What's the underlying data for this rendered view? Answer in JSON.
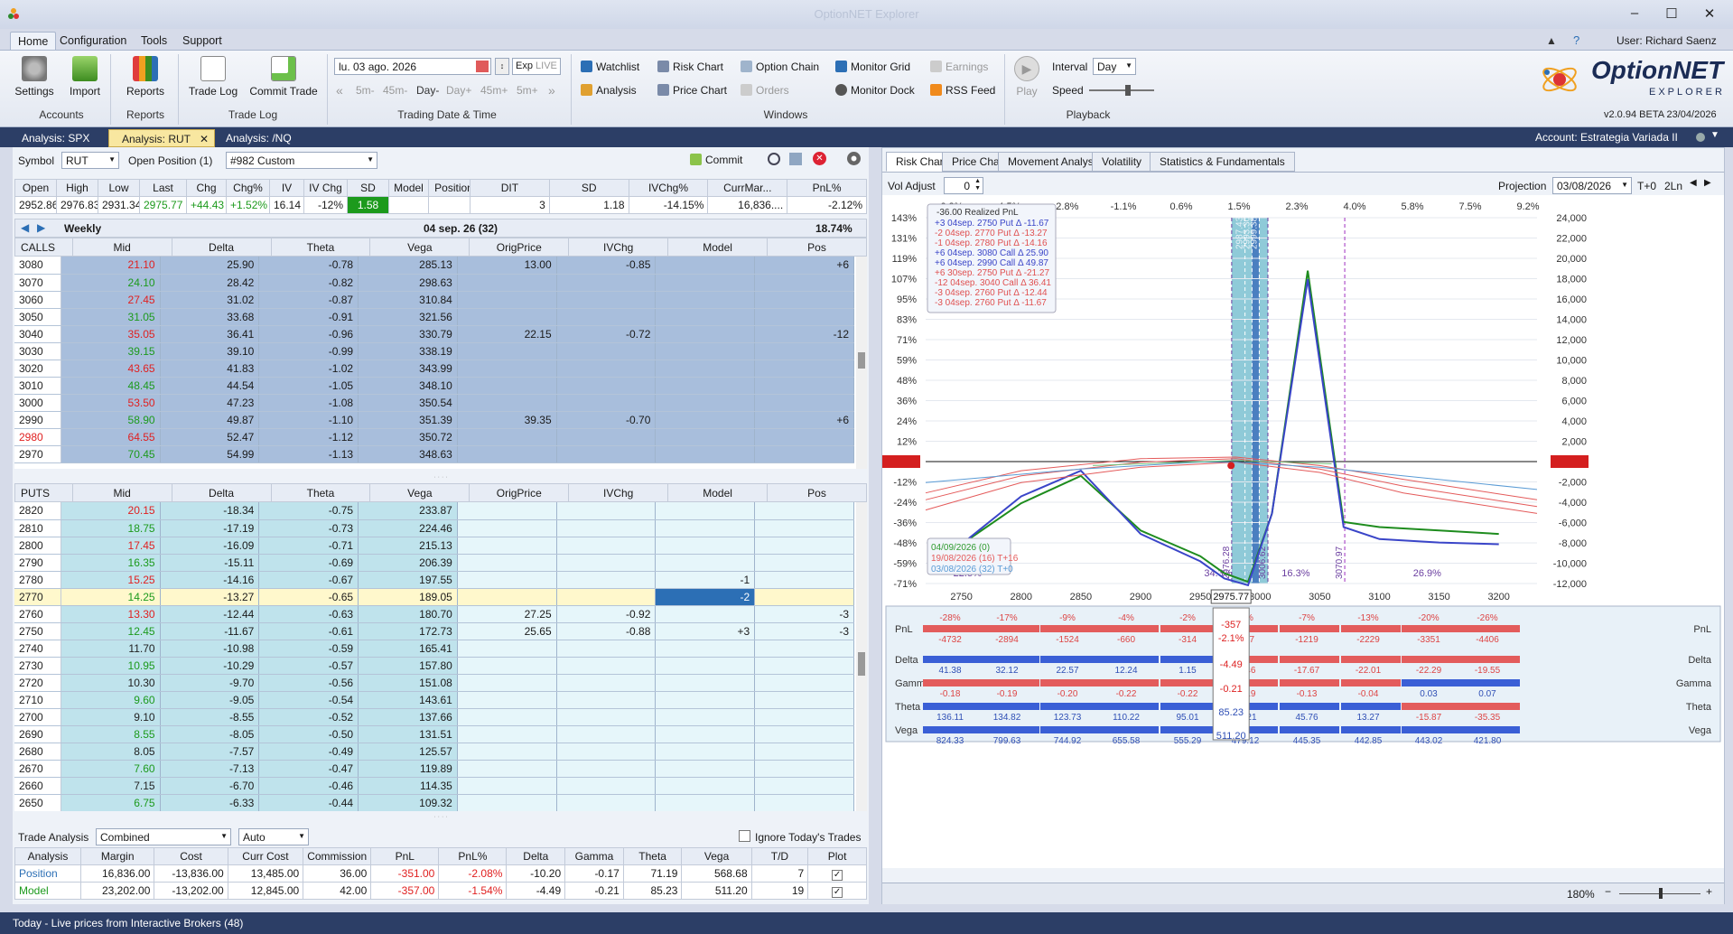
{
  "app": {
    "title": "OptionNET Explorer",
    "user": "User: Richard Saenz",
    "version": "v2.0.94 BETA 23/04/2026",
    "logo": "OptionNET",
    "logo_sub": "EXPLORER"
  },
  "menu": [
    "Home",
    "Configuration",
    "Tools",
    "Support"
  ],
  "ribbon": {
    "settings": "Settings",
    "import": "Import",
    "accounts": "Accounts",
    "reports_btn": "Reports",
    "reports": "Reports",
    "trade_log_btn": "Trade Log",
    "commit_trade": "Commit Trade",
    "trade_log": "Trade Log",
    "date_value": "lu. 03 ago. 2026",
    "exp": "Exp",
    "live": "LIVE",
    "steps": [
      "5m-",
      "45m-",
      "Day-",
      "Day+",
      "45m+",
      "5m+"
    ],
    "date_group": "Trading Date & Time",
    "watchlist": "Watchlist",
    "analysis": "Analysis",
    "risk_chart": "Risk Chart",
    "price_chart": "Price Chart",
    "option_chain": "Option Chain",
    "orders": "Orders",
    "monitor_grid": "Monitor Grid",
    "monitor_dock": "Monitor Dock",
    "earnings": "Earnings",
    "rss_feed": "RSS Feed",
    "windows": "Windows",
    "play": "Play",
    "interval": "Interval",
    "interval_value": "Day",
    "speed": "Speed",
    "playback": "Playback"
  },
  "tabs": [
    "Analysis: SPX",
    "Analysis: RUT",
    "Analysis: /NQ"
  ],
  "account": "Account: Estrategia Variada II",
  "left": {
    "symbol_label": "Symbol",
    "symbol": "RUT",
    "open_position_label": "Open Position (1)",
    "position": "#982 Custom",
    "commit": "Commit",
    "quote_head": [
      "Open",
      "High",
      "Low",
      "Last",
      "Chg",
      "Chg%",
      "IV",
      "IV Chg",
      "SD",
      "Model",
      "Position"
    ],
    "quote_vals": [
      "2952.86",
      "2976.83",
      "2931.34",
      "2975.77",
      "+44.43",
      "+1.52%",
      "16.14",
      "-12%",
      "1.58",
      "",
      ""
    ],
    "stat_head": [
      "DIT",
      "SD",
      "IVChg%",
      "CurrMar...",
      "PnL%"
    ],
    "stat_vals": [
      "3",
      "1.18",
      "-14.15%",
      "16,836....",
      "-2.12%"
    ],
    "expiry_label": "Weekly",
    "expiry_date": "04 sep. 26 (32)",
    "expiry_iv": "18.74%",
    "chain_head": [
      "Mid",
      "Delta",
      "Theta",
      "Vega",
      "OrigPrice",
      "IVChg",
      "Model",
      "Pos"
    ],
    "calls_label": "CALLS",
    "puts_label": "PUTS",
    "calls": [
      [
        "3080",
        "21.10",
        "25.90",
        "-0.78",
        "285.13",
        "13.00",
        "-0.85",
        "",
        "+6"
      ],
      [
        "3070",
        "24.10",
        "28.42",
        "-0.82",
        "298.63",
        "",
        "",
        "",
        ""
      ],
      [
        "3060",
        "27.45",
        "31.02",
        "-0.87",
        "310.84",
        "",
        "",
        "",
        ""
      ],
      [
        "3050",
        "31.05",
        "33.68",
        "-0.91",
        "321.56",
        "",
        "",
        "",
        ""
      ],
      [
        "3040",
        "35.05",
        "36.41",
        "-0.96",
        "330.79",
        "22.15",
        "-0.72",
        "",
        "-12"
      ],
      [
        "3030",
        "39.15",
        "39.10",
        "-0.99",
        "338.19",
        "",
        "",
        "",
        ""
      ],
      [
        "3020",
        "43.65",
        "41.83",
        "-1.02",
        "343.99",
        "",
        "",
        "",
        ""
      ],
      [
        "3010",
        "48.45",
        "44.54",
        "-1.05",
        "348.10",
        "",
        "",
        "",
        ""
      ],
      [
        "3000",
        "53.50",
        "47.23",
        "-1.08",
        "350.54",
        "",
        "",
        "",
        ""
      ],
      [
        "2990",
        "58.90",
        "49.87",
        "-1.10",
        "351.39",
        "39.35",
        "-0.70",
        "",
        "+6"
      ],
      [
        "2980",
        "64.55",
        "52.47",
        "-1.12",
        "350.72",
        "",
        "",
        "",
        ""
      ],
      [
        "2970",
        "70.45",
        "54.99",
        "-1.13",
        "348.63",
        "",
        "",
        "",
        ""
      ]
    ],
    "puts": [
      [
        "2820",
        "20.15",
        "-18.34",
        "-0.75",
        "233.87",
        "",
        "",
        "",
        ""
      ],
      [
        "2810",
        "18.75",
        "-17.19",
        "-0.73",
        "224.46",
        "",
        "",
        "",
        ""
      ],
      [
        "2800",
        "17.45",
        "-16.09",
        "-0.71",
        "215.13",
        "",
        "",
        "",
        ""
      ],
      [
        "2790",
        "16.35",
        "-15.11",
        "-0.69",
        "206.39",
        "",
        "",
        "",
        ""
      ],
      [
        "2780",
        "15.25",
        "-14.16",
        "-0.67",
        "197.55",
        "",
        "",
        "-1",
        ""
      ],
      [
        "2770",
        "14.25",
        "-13.27",
        "-0.65",
        "189.05",
        "",
        "",
        "-2",
        ""
      ],
      [
        "2760",
        "13.30",
        "-12.44",
        "-0.63",
        "180.70",
        "27.25",
        "-0.92",
        "",
        "-3"
      ],
      [
        "2750",
        "12.45",
        "-11.67",
        "-0.61",
        "172.73",
        "25.65",
        "-0.88",
        "+3",
        "-3"
      ],
      [
        "2740",
        "11.70",
        "-10.98",
        "-0.59",
        "165.41",
        "",
        "",
        "",
        ""
      ],
      [
        "2730",
        "10.95",
        "-10.29",
        "-0.57",
        "157.80",
        "",
        "",
        "",
        ""
      ],
      [
        "2720",
        "10.30",
        "-9.70",
        "-0.56",
        "151.08",
        "",
        "",
        "",
        ""
      ],
      [
        "2710",
        "9.60",
        "-9.05",
        "-0.54",
        "143.61",
        "",
        "",
        "",
        ""
      ],
      [
        "2700",
        "9.10",
        "-8.55",
        "-0.52",
        "137.66",
        "",
        "",
        "",
        ""
      ],
      [
        "2690",
        "8.55",
        "-8.05",
        "-0.50",
        "131.51",
        "",
        "",
        "",
        ""
      ],
      [
        "2680",
        "8.05",
        "-7.57",
        "-0.49",
        "125.57",
        "",
        "",
        "",
        ""
      ],
      [
        "2670",
        "7.60",
        "-7.13",
        "-0.47",
        "119.89",
        "",
        "",
        "",
        ""
      ],
      [
        "2660",
        "7.15",
        "-6.70",
        "-0.46",
        "114.35",
        "",
        "",
        "",
        ""
      ],
      [
        "2650",
        "6.75",
        "-6.33",
        "-0.44",
        "109.32",
        "",
        "",
        "",
        ""
      ]
    ],
    "ta_label": "Trade Analysis",
    "ta_combined": "Combined",
    "ta_auto": "Auto",
    "ignore_today": "Ignore Today's Trades",
    "ta_head": [
      "Analysis",
      "Margin",
      "Cost",
      "Curr Cost",
      "Commission",
      "PnL",
      "PnL%",
      "Delta",
      "Gamma",
      "Theta",
      "Vega",
      "T/D",
      "Plot"
    ],
    "ta_rows": [
      [
        "Position",
        "16,836.00",
        "-13,836.00",
        "13,485.00",
        "36.00",
        "-351.00",
        "-2.08%",
        "-10.20",
        "-0.17",
        "71.19",
        "568.68",
        "7"
      ],
      [
        "Model",
        "23,202.00",
        "-13,202.00",
        "12,845.00",
        "42.00",
        "-357.00",
        "-1.54%",
        "-4.49",
        "-0.21",
        "85.23",
        "511.20",
        "19"
      ]
    ]
  },
  "chart_tabs": [
    "Risk Chart",
    "Price Chart",
    "Movement Analysis",
    "Volatility",
    "Statistics & Fundamentals"
  ],
  "chart_controls": {
    "vol_adjust": "Vol Adjust",
    "vol_value": "0",
    "projection": "Projection",
    "proj_date": "03/08/2026",
    "t0": "T+0",
    "twoln": "2Ln",
    "zoom": "180%"
  },
  "chart_data": {
    "type": "line",
    "title": "",
    "x_ticks": [
      "2750",
      "2800",
      "2850",
      "2900",
      "2950",
      "3000",
      "3050",
      "3100",
      "3150",
      "3200"
    ],
    "x_current": "2975.77",
    "pct_left": [
      "143%",
      "131%",
      "119%",
      "107%",
      "95%",
      "83%",
      "71%",
      "59%",
      "48%",
      "36%",
      "24%",
      "12%",
      "-2%",
      "-12%",
      "-24%",
      "-36%",
      "-48%",
      "-59%",
      "-71%"
    ],
    "pnl_right": [
      "24,000",
      "22,000",
      "20,000",
      "18,000",
      "16,000",
      "14,000",
      "12,000",
      "10,000",
      "8,000",
      "6,000",
      "4,000",
      "2,000",
      "-357",
      "-2,000",
      "-4,000",
      "-6,000",
      "-8,000",
      "-10,000",
      "-12,000"
    ],
    "sd_pct": [
      "-6.2%",
      "-4.5%",
      "-2.8%",
      "-1.1%",
      "0.6%",
      "1.5%",
      "2.3%",
      "4.0%",
      "5.8%",
      "7.5%",
      "9.2%"
    ],
    "vlines": [
      "2976.28",
      "2993.30",
      "2999.38",
      "2987.43",
      "3006.62",
      "3070.97"
    ],
    "zone_pcts": [
      "22.5%",
      "34.3%",
      "16.3%",
      "26.9%"
    ],
    "realized": "-36.00 Realized PnL",
    "legs": [
      "+3 04sep. 2750 Put Δ -11.67",
      "-2 04sep. 2770 Put Δ -13.27",
      "-1 04sep. 2780 Put Δ -14.16",
      "+6 04sep. 3080 Call Δ 25.90",
      "+6 04sep. 2990 Call Δ 49.87",
      "+6 30sep. 2750 Put Δ -21.27",
      "-12 04sep. 3040 Call Δ 36.41",
      "-3 04sep. 2760 Put Δ -12.44",
      "-3 04sep. 2760 Put Δ -11.67"
    ],
    "series": [
      {
        "name": "04/09/2026 (0)",
        "color": "#2e9a2e"
      },
      {
        "name": "19/08/2026 (16) T+16",
        "color": "#e45a5a"
      },
      {
        "name": "03/08/2026 (32) T+0",
        "color": "#5a9bd5"
      }
    ],
    "expiry_curve": [
      [
        2750,
        -48
      ],
      [
        2800,
        -24
      ],
      [
        2850,
        -8
      ],
      [
        2900,
        -40
      ],
      [
        2950,
        -55
      ],
      [
        2970,
        -65
      ],
      [
        2990,
        -70
      ],
      [
        3010,
        -30
      ],
      [
        3040,
        112
      ],
      [
        3070,
        -35
      ],
      [
        3100,
        -38
      ],
      [
        3150,
        -40
      ],
      [
        3200,
        -42
      ]
    ]
  },
  "greeks": {
    "labels": [
      "PnL",
      "Delta",
      "Gamma",
      "Theta",
      "Vega"
    ],
    "pnl_pct": [
      "-28%",
      "-17%",
      "-9%",
      "-4%",
      "-2%",
      "-3%",
      "-7%",
      "-13%",
      "-20%",
      "-26%"
    ],
    "pnl": [
      "-4732",
      "-2894",
      "-1524",
      "-660",
      "-314",
      "-527",
      "-1219",
      "-2229",
      "-3351",
      "-4406"
    ],
    "delta": [
      "41.38",
      "32.12",
      "22.57",
      "12.24",
      "1.15",
      "-9.46",
      "-17.67",
      "-22.01",
      "-22.29",
      "-19.55"
    ],
    "gamma": [
      "-0.18",
      "-0.19",
      "-0.20",
      "-0.22",
      "-0.22",
      "-0.19",
      "-0.13",
      "-0.04",
      "0.03",
      "0.07"
    ],
    "theta": [
      "136.11",
      "134.82",
      "123.73",
      "110.22",
      "95.01",
      "74.21",
      "45.76",
      "13.27",
      "-15.87",
      "-35.35"
    ],
    "vega": [
      "824.33",
      "799.63",
      "744.92",
      "655.58",
      "555.29",
      "479.12",
      "445.35",
      "442.85",
      "443.02",
      "421.80"
    ],
    "current": [
      "-357",
      "-2.1%",
      "-4.49",
      "-0.21",
      "85.23",
      "511.20"
    ]
  },
  "status": "Today - Live prices from Interactive Brokers (48)"
}
